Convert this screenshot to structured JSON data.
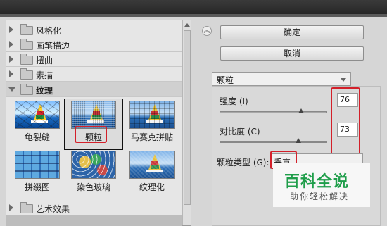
{
  "filter_gallery": {
    "categories": [
      {
        "label": "风格化"
      },
      {
        "label": "画笔描边"
      },
      {
        "label": "扭曲"
      },
      {
        "label": "素描"
      },
      {
        "label": "纹理"
      },
      {
        "label": "艺术效果"
      }
    ],
    "thumbnails": [
      {
        "label": "龟裂缝"
      },
      {
        "label": "颗粒"
      },
      {
        "label": "马赛克拼贴"
      },
      {
        "label": "拼缀图"
      },
      {
        "label": "染色玻璃"
      },
      {
        "label": "纹理化"
      }
    ],
    "selected": "颗粒"
  },
  "settings": {
    "ok_label": "确定",
    "cancel_label": "取消",
    "filter_selected": "颗粒",
    "intensity_label": "强度 (I)",
    "intensity_value": "76",
    "intensity_level": 0.76,
    "contrast_label": "对比度 (C)",
    "contrast_value": "73",
    "contrast_level": 0.73,
    "grain_type_label": "颗粒类型 (G):",
    "grain_type_value": "垂直"
  },
  "watermark": {
    "title": "百科全说",
    "subtitle": "助你轻松解决"
  },
  "colors": {
    "highlight_red": "#d3202a",
    "watermark_green": "#1f9e4a"
  }
}
